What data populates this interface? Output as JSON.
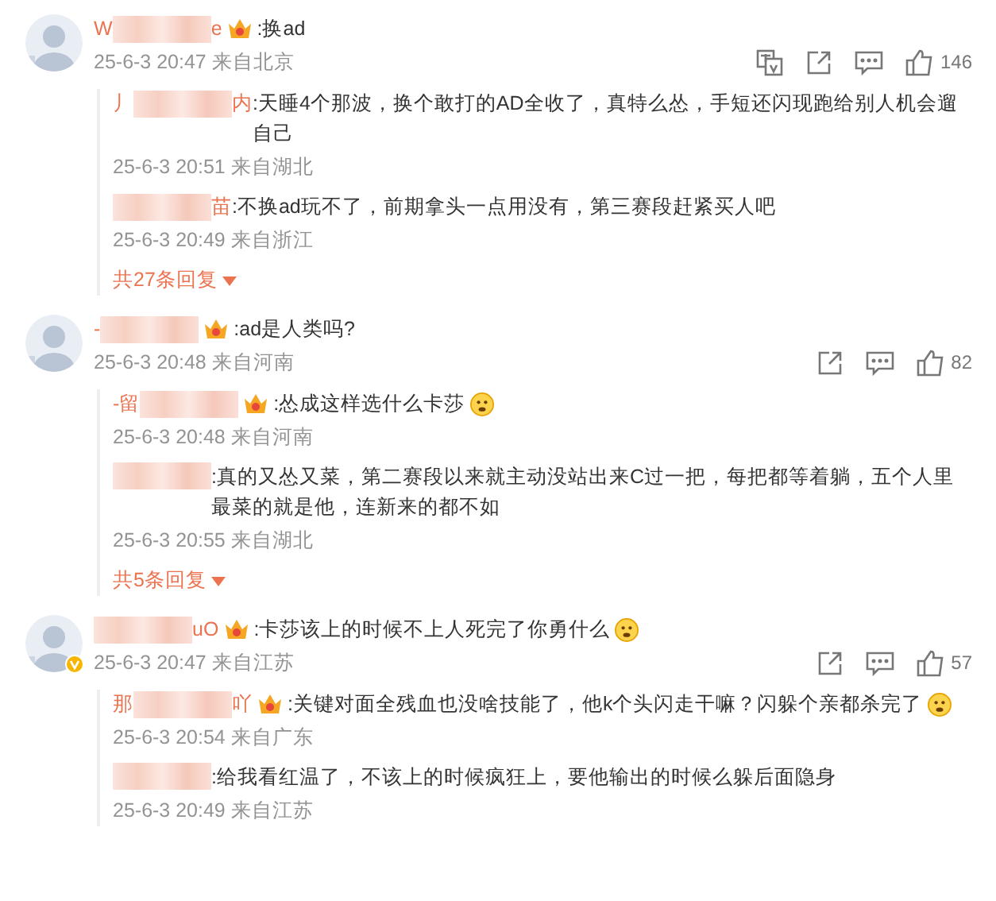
{
  "comments": [
    {
      "name_head": "W",
      "name_tail": "e",
      "vip_badge": true,
      "verified": false,
      "text": ":换ad",
      "emoji": false,
      "time": "25-6-3 20:47 来自北京",
      "actions": [
        {
          "kind": "translate"
        },
        {
          "kind": "share"
        },
        {
          "kind": "comment"
        },
        {
          "kind": "like",
          "count": "146"
        }
      ],
      "replies": [
        {
          "name_head": "丿",
          "name_tail": "内",
          "vip_badge": false,
          "text": ":天睡4个那波，换个敢打的AD全收了，真特么怂，手短还闪现跑给别人机会遛自己",
          "emoji": false,
          "time": "25-6-3 20:51 来自湖北"
        },
        {
          "name_tail": "苗",
          "vip_badge": false,
          "text": ":不换ad玩不了，前期拿头一点用没有，第三赛段赶紧买人吧",
          "emoji": false,
          "time": "25-6-3 20:49 来自浙江"
        }
      ],
      "more": "共27条回复"
    },
    {
      "name_head": "-",
      "vip_badge": true,
      "verified": false,
      "text": ":ad是人类吗?",
      "emoji": false,
      "time": "25-6-3 20:48 来自河南",
      "actions": [
        {
          "kind": "share"
        },
        {
          "kind": "comment"
        },
        {
          "kind": "like",
          "count": "82"
        }
      ],
      "replies": [
        {
          "name_head": "-留",
          "vip_badge": true,
          "text": ":怂成这样选什么卡莎",
          "emoji": true,
          "time": "25-6-3 20:48 来自河南"
        },
        {
          "vip_badge": false,
          "text": ":真的又怂又菜，第二赛段以来就主动没站出来C过一把，每把都等着躺，五个人里最菜的就是他，连新来的都不如",
          "emoji": false,
          "time": "25-6-3 20:55 来自湖北"
        }
      ],
      "more": "共5条回复"
    },
    {
      "name_tail": "uO",
      "vip_badge": true,
      "verified": true,
      "text": ":卡莎该上的时候不上人死完了你勇什么",
      "emoji": true,
      "time": "25-6-3 20:47 来自江苏",
      "actions": [
        {
          "kind": "share"
        },
        {
          "kind": "comment"
        },
        {
          "kind": "like",
          "count": "57"
        }
      ],
      "replies": [
        {
          "name_head": "那",
          "name_tail": "吖",
          "vip_badge": true,
          "text": ":关键对面全残血也没啥技能了，他k个头闪走干嘛？闪躲个亲都杀完了",
          "emoji": true,
          "time": "25-6-3 20:54 来自广东"
        },
        {
          "vip_badge": false,
          "text": ":给我看红温了，不该上的时候疯狂上，要他输出的时候么躲后面隐身",
          "emoji": false,
          "time": "25-6-3 20:49 来自江苏"
        }
      ]
    }
  ]
}
